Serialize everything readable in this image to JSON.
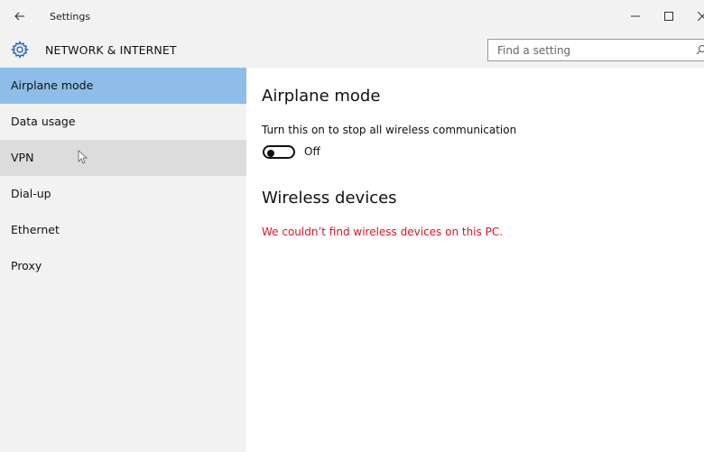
{
  "window": {
    "title": "Settings",
    "back_icon": "back-arrow-icon",
    "controls": {
      "minimize": "—",
      "maximize": "☐",
      "close": "✕"
    }
  },
  "header": {
    "icon": "gear-icon",
    "title": "NETWORK & INTERNET"
  },
  "search": {
    "placeholder": "Find a setting",
    "icon": "search-icon"
  },
  "sidebar": {
    "items": [
      {
        "label": "Airplane mode",
        "state": "selected"
      },
      {
        "label": "Data usage",
        "state": "normal"
      },
      {
        "label": "VPN",
        "state": "hover"
      },
      {
        "label": "Dial-up",
        "state": "normal"
      },
      {
        "label": "Ethernet",
        "state": "normal"
      },
      {
        "label": "Proxy",
        "state": "normal"
      }
    ]
  },
  "main": {
    "heading": "Airplane mode",
    "description": "Turn this on to stop all wireless communication",
    "toggle_state": "Off",
    "wireless_heading": "Wireless devices",
    "error_message": "We couldn’t find wireless devices on this PC."
  },
  "colors": {
    "selected": "#8dbde8",
    "hover": "#dcdcdc",
    "sidebar_bg": "#f2f2f2",
    "error": "#e81123"
  }
}
